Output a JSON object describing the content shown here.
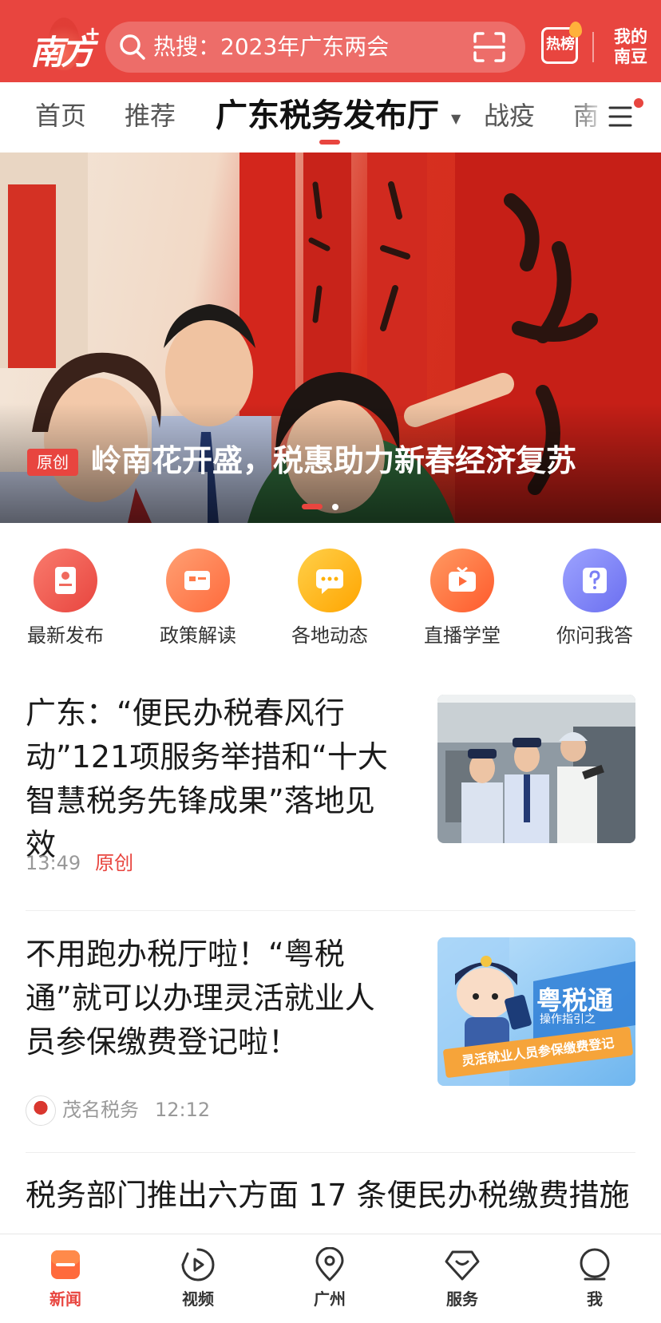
{
  "header": {
    "logo_text": "南方",
    "logo_plus": "+",
    "search_text": "热搜：2023年广东两会",
    "hot_label": "热榜",
    "mine_line1": "我的",
    "mine_line2": "南豆"
  },
  "tabs": [
    {
      "label": "首页",
      "active": false
    },
    {
      "label": "推荐",
      "active": false
    },
    {
      "label": "广东税务发布厅",
      "active": true
    },
    {
      "label": "战疫",
      "active": false
    },
    {
      "label": "南",
      "active": false
    }
  ],
  "banner": {
    "badge": "原创",
    "caption": "岭南花开盛，税惠助力新春经济复苏",
    "page_count": 2,
    "active_index": 0
  },
  "quick_entries": [
    {
      "label": "最新发布",
      "icon": "document-icon",
      "color": "#ef5350"
    },
    {
      "label": "政策解读",
      "icon": "card-icon",
      "color": "#ff7043"
    },
    {
      "label": "各地动态",
      "icon": "chat-icon",
      "color": "#ffb300"
    },
    {
      "label": "直播学堂",
      "icon": "tv-icon",
      "color": "#ff6d3a"
    },
    {
      "label": "你问我答",
      "icon": "question-icon",
      "color": "#7b7ff5"
    }
  ],
  "news": [
    {
      "title": "广东：“便民办税春风行动”121项服务举措和“十大智慧税务先锋成果”落地见效",
      "time": "13:49",
      "tag": "原创"
    },
    {
      "title": "不用跑办税厅啦！“粤税通”就可以办理灵活就业人员参保缴费登记啦！",
      "source": "茂名税务",
      "time": "12:12",
      "thumb_title": "粤税通",
      "thumb_subtitle": "操作指引之",
      "thumb_ribbon": "灵活就业人员参保缴费登记"
    },
    {
      "title": "税务部门推出六方面 17 条便民办税缴费措施"
    }
  ],
  "bottom_nav": [
    {
      "label": "新闻",
      "icon": "news-icon",
      "active": true
    },
    {
      "label": "视频",
      "icon": "video-icon",
      "active": false
    },
    {
      "label": "广州",
      "icon": "location-icon",
      "active": false
    },
    {
      "label": "服务",
      "icon": "service-icon",
      "active": false
    },
    {
      "label": "我",
      "icon": "profile-icon",
      "active": false
    }
  ],
  "colors": {
    "brand": "#e8453f",
    "text": "#1a1a1a",
    "muted": "#999999"
  }
}
